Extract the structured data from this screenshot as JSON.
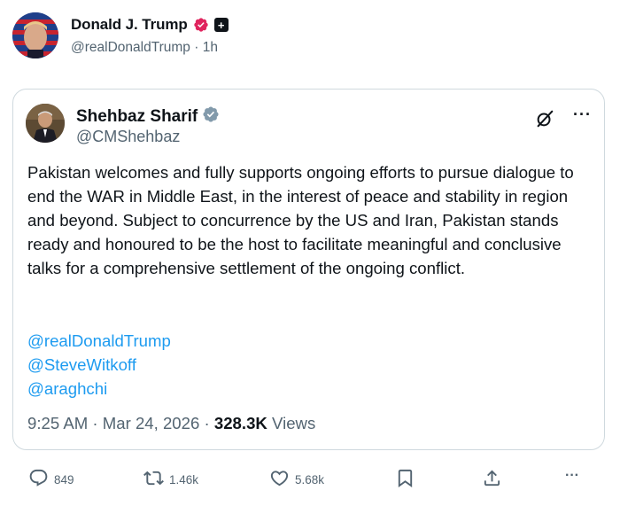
{
  "post": {
    "author_name": "Donald J. Trump",
    "author_handle": "@realDonaldTrump",
    "time_ago": "1h",
    "separator": "·",
    "plus_badge_glyph": "+"
  },
  "quote": {
    "author_name": "Shehbaz Sharif",
    "author_handle": "@CMShehbaz",
    "body": "Pakistan welcomes and fully supports ongoing efforts to pursue dialogue to end the WAR in Middle East, in the interest of peace and stability in region and beyond. Subject to concurrence by the US and Iran, Pakistan stands ready and honoured to be the host to facilitate meaningful and conclusive talks for a comprehensive settlement of the ongoing conflict.",
    "mentions": [
      "@realDonaldTrump",
      "@SteveWitkoff",
      "@araghchi"
    ],
    "time": "9:25 AM",
    "date": "Mar 24, 2026",
    "views_count": "328.3K",
    "views_label": "Views",
    "more_glyph": "···"
  },
  "actions": {
    "replies": "849",
    "reposts": "1.46k",
    "likes": "5.68k"
  },
  "colors": {
    "link": "#1d9bf0",
    "muted": "#536471",
    "verified_gray": "#829aab",
    "verified_red": "#e0245e",
    "border": "#cfd9de"
  },
  "icons": [
    "verified-badge-icon",
    "plus-badge-icon",
    "grok-icon",
    "more-icon",
    "reply-icon",
    "repost-icon",
    "like-icon",
    "bookmark-icon",
    "share-icon"
  ]
}
